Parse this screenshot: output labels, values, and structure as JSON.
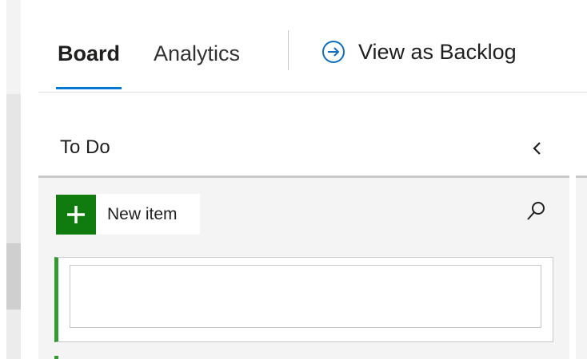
{
  "tabs": [
    {
      "label": "Board",
      "selected": true
    },
    {
      "label": "Analytics",
      "selected": false
    }
  ],
  "view_backlog": {
    "label": "View as Backlog",
    "icon": "arrow-circle-right-icon"
  },
  "column": {
    "title": "To Do",
    "collapse_icon": "chevron-left-icon",
    "new_item_label": "New item",
    "new_item_icon": "plus-icon",
    "search_icon": "search-icon",
    "new_card": {
      "value": "",
      "placeholder": ""
    }
  },
  "colors": {
    "accent": "#0078d4",
    "new_item_green": "#107c10",
    "card_stripe": "#339933",
    "column_bg": "#f4f4f4"
  }
}
